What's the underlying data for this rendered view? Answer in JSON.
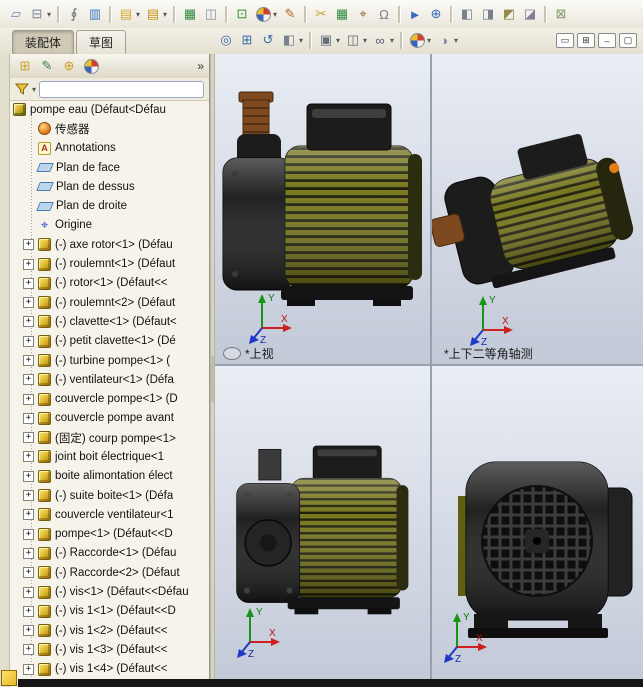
{
  "toolbar_main": {
    "icons": [
      {
        "name": "new-document-icon",
        "glyph": "▱",
        "color": "#6a86b8"
      },
      {
        "name": "print-icon",
        "glyph": "⊟",
        "color": "#7a8699"
      },
      {
        "name": "print-dropdown-icon",
        "glyph": "▾",
        "cls": "dd"
      },
      {
        "name": "separator",
        "cls": "sep"
      },
      {
        "name": "attachment-icon",
        "glyph": "∮",
        "color": "#5a6470"
      },
      {
        "name": "column-chart-icon",
        "glyph": "▥",
        "color": "#3c76c2"
      },
      {
        "name": "separator",
        "cls": "sep"
      },
      {
        "name": "open-folder-icon",
        "glyph": "▤",
        "color": "#d7a928"
      },
      {
        "name": "open-folder-dropdown-icon",
        "glyph": "▾",
        "cls": "dd"
      },
      {
        "name": "open-document-icon",
        "glyph": "▤",
        "color": "#c79418"
      },
      {
        "name": "open-document-dropdown-icon",
        "glyph": "▾",
        "cls": "dd"
      },
      {
        "name": "separator",
        "cls": "sep"
      },
      {
        "name": "save-icon",
        "glyph": "▦",
        "color": "#2f8a3f"
      },
      {
        "name": "window-panes-icon",
        "glyph": "◫",
        "color": "#8a94a4"
      },
      {
        "name": "separator",
        "cls": "sep"
      },
      {
        "name": "rebuild-icon",
        "glyph": "⊡",
        "color": "#2f9a2f"
      },
      {
        "name": "appearance-ball-icon",
        "cls": "ball"
      },
      {
        "name": "appearance-dropdown-icon",
        "glyph": "▾",
        "cls": "dd"
      },
      {
        "name": "edit-sketch-icon",
        "glyph": "✎",
        "color": "#b06a28"
      },
      {
        "name": "separator",
        "cls": "sep"
      },
      {
        "name": "trim-icon",
        "glyph": "✂",
        "color": "#c2a224"
      },
      {
        "name": "design-table-icon",
        "glyph": "▦",
        "color": "#2f8a3f"
      },
      {
        "name": "measure-icon",
        "glyph": "⌖",
        "color": "#8a6a20"
      },
      {
        "name": "mass-properties-icon",
        "glyph": "Ω",
        "color": "#76808e"
      },
      {
        "name": "separator",
        "cls": "sep"
      },
      {
        "name": "select-arrow-icon",
        "glyph": "►",
        "color": "#3a6ac0"
      },
      {
        "name": "move-component-icon",
        "glyph": "⊕",
        "color": "#3a6ac0"
      },
      {
        "name": "separator",
        "cls": "sep"
      },
      {
        "name": "isometric-view-icon",
        "glyph": "◧",
        "color": "#76808e"
      },
      {
        "name": "section-view-icon",
        "glyph": "◨",
        "color": "#76808e"
      },
      {
        "name": "assembly-cube-icon",
        "glyph": "◩",
        "color": "#9a8a4a"
      },
      {
        "name": "exploded-view-icon",
        "glyph": "◪",
        "color": "#8a7a9a"
      },
      {
        "name": "separator",
        "cls": "sep"
      },
      {
        "name": "interference-check-icon",
        "glyph": "⊠",
        "color": "#7a9a6a"
      }
    ]
  },
  "command_tabs": {
    "assembly": "装配体",
    "sketch": "草图"
  },
  "view_toolbar": {
    "icons": [
      {
        "name": "zoom-fit-icon",
        "glyph": "◎",
        "color": "#3a6aaa"
      },
      {
        "name": "zoom-area-icon",
        "glyph": "⊞",
        "color": "#3a6aaa"
      },
      {
        "name": "previous-view-icon",
        "glyph": "↺",
        "color": "#3a6aaa"
      },
      {
        "name": "section-view-icon",
        "glyph": "◧",
        "color": "#76808e"
      },
      {
        "name": "section-dropdown-icon",
        "glyph": "▾",
        "cls": "dd"
      },
      {
        "name": "separator",
        "cls": "sep"
      },
      {
        "name": "view-orientation-icon",
        "glyph": "▣",
        "color": "#666e7a"
      },
      {
        "name": "view-orientation-dropdown-icon",
        "glyph": "▾",
        "cls": "dd"
      },
      {
        "name": "display-style-icon",
        "glyph": "◫",
        "color": "#666e7a"
      },
      {
        "name": "display-style-dropdown-icon",
        "glyph": "▾",
        "cls": "dd"
      },
      {
        "name": "hide-show-items-icon",
        "glyph": "∞",
        "color": "#556070"
      },
      {
        "name": "hide-show-dropdown-icon",
        "glyph": "▾",
        "cls": "dd"
      },
      {
        "name": "separator",
        "cls": "sep"
      },
      {
        "name": "edit-appearance-icon",
        "cls": "ball"
      },
      {
        "name": "edit-appearance-dropdown-icon",
        "glyph": "▾",
        "cls": "dd"
      },
      {
        "name": "scene-icon",
        "glyph": "◑",
        "color": "#7a86a0"
      },
      {
        "name": "scene-dropdown-icon",
        "glyph": "▾",
        "cls": "dd"
      }
    ],
    "right_icons": [
      {
        "name": "viewport-single-icon",
        "glyph": "▭",
        "cls": "winbox"
      },
      {
        "name": "viewport-split-icon",
        "glyph": "⊞",
        "cls": "winbox"
      },
      {
        "name": "minimize-window-icon",
        "glyph": "–",
        "cls": "winbox"
      },
      {
        "name": "restore-window-icon",
        "glyph": "▢",
        "cls": "winbox"
      }
    ]
  },
  "panel": {
    "tabs": [
      {
        "name": "featuremanager-tab-icon",
        "glyph": "⊞",
        "color": "#caa227"
      },
      {
        "name": "propertymanager-tab-icon",
        "glyph": "✎",
        "color": "#3f7f3f"
      },
      {
        "name": "configurationmanager-tab-icon",
        "glyph": "⊕",
        "color": "#caa227"
      },
      {
        "name": "appearances-tab-icon",
        "cls": "ball"
      }
    ],
    "chevron": "»",
    "filter": {
      "value": "",
      "placeholder": ""
    }
  },
  "tree": {
    "items": [
      {
        "name": "tree-item-root-pompe-eau",
        "cls": "asm root",
        "exp": "",
        "label": "pompe eau (Défaut<Défau"
      },
      {
        "name": "tree-item-sensors",
        "cls": "sensor",
        "exp": "",
        "label": "传感器"
      },
      {
        "name": "tree-item-annotations",
        "cls": "ann",
        "exp": "",
        "label": "Annotations"
      },
      {
        "name": "tree-item-plan-de-face",
        "cls": "plane",
        "exp": "",
        "label": "Plan de face"
      },
      {
        "name": "tree-item-plan-de-dessus",
        "cls": "plane",
        "exp": "",
        "label": "Plan de dessus"
      },
      {
        "name": "tree-item-plan-de-droite",
        "cls": "plane",
        "exp": "",
        "label": "Plan de droite"
      },
      {
        "name": "tree-item-origine",
        "cls": "origin",
        "exp": "",
        "label": "Origine"
      },
      {
        "name": "tree-item-axe-rotor-1",
        "cls": "part",
        "exp": "+",
        "label": "(-) axe rotor<1> (Défau"
      },
      {
        "name": "tree-item-roulemnt-1",
        "cls": "part",
        "exp": "+",
        "label": "(-) roulemnt<1> (Défaut"
      },
      {
        "name": "tree-item-rotor-1",
        "cls": "part",
        "exp": "+",
        "label": "(-) rotor<1> (Défaut<<"
      },
      {
        "name": "tree-item-roulemnt-2",
        "cls": "part",
        "exp": "+",
        "label": "(-) roulemnt<2> (Défaut"
      },
      {
        "name": "tree-item-clavette-1",
        "cls": "part",
        "exp": "+",
        "label": "(-) clavette<1> (Défaut<"
      },
      {
        "name": "tree-item-petit-clavette-1",
        "cls": "part",
        "exp": "+",
        "label": "(-) petit clavette<1> (Dé"
      },
      {
        "name": "tree-item-turbine-pompe-1",
        "cls": "part",
        "exp": "+",
        "label": "(-) turbine pompe<1> ("
      },
      {
        "name": "tree-item-ventilateur-1",
        "cls": "part",
        "exp": "+",
        "label": "(-) ventilateur<1> (Défa"
      },
      {
        "name": "tree-item-couvercle-pompe-1",
        "cls": "part",
        "exp": "+",
        "label": "couvercle pompe<1> (D"
      },
      {
        "name": "tree-item-couvercle-pompe-avant",
        "cls": "part",
        "exp": "+",
        "label": "couvercle pompe avant"
      },
      {
        "name": "tree-item-courp-pompe-1",
        "cls": "part",
        "exp": "+",
        "label": "(固定) courp pompe<1>"
      },
      {
        "name": "tree-item-joint-boit-electrique-1",
        "cls": "part",
        "exp": "+",
        "label": "joint boit électrique<1"
      },
      {
        "name": "tree-item-boite-alimontation-elect",
        "cls": "part",
        "exp": "+",
        "label": "boite alimontation élect"
      },
      {
        "name": "tree-item-suite-boite-1",
        "cls": "part",
        "exp": "+",
        "label": "(-) suite boite<1> (Défa"
      },
      {
        "name": "tree-item-couvercle-ventilateur-1",
        "cls": "part",
        "exp": "+",
        "label": "couvercle ventilateur<1"
      },
      {
        "name": "tree-item-pompe-1",
        "cls": "part",
        "exp": "+",
        "label": "pompe<1> (Défaut<<D"
      },
      {
        "name": "tree-item-raccorde-1",
        "cls": "part",
        "exp": "+",
        "label": "(-) Raccorde<1> (Défau"
      },
      {
        "name": "tree-item-raccorde-2",
        "cls": "part",
        "exp": "+",
        "label": "(-) Raccorde<2> (Défaut"
      },
      {
        "name": "tree-item-vis-1",
        "cls": "part",
        "exp": "+",
        "label": "(-) vis<1> (Défaut<<Défau"
      },
      {
        "name": "tree-item-vis1-1",
        "cls": "part",
        "exp": "+",
        "label": "(-) vis 1<1> (Défaut<<D"
      },
      {
        "name": "tree-item-vis1-2",
        "cls": "part",
        "exp": "+",
        "label": "(-) vis 1<2> (Défaut<<"
      },
      {
        "name": "tree-item-vis1-3",
        "cls": "part",
        "exp": "+",
        "label": "(-) vis 1<3> (Défaut<<"
      },
      {
        "name": "tree-item-vis1-4",
        "cls": "part",
        "exp": "+",
        "label": "(-) vis 1<4> (Défaut<<"
      }
    ]
  },
  "viewports": {
    "tl_label": "*上视",
    "tr_label": "*上下二等角轴测",
    "triad": {
      "x": "X",
      "y": "Y",
      "z": "Z"
    }
  },
  "colors": {
    "olive": "#74741a",
    "fin": "#1b1b08",
    "pump_black": "#1c1c1c",
    "fitting_brown": "#7c4a1e",
    "accent_orange": "#e67d1a",
    "vp_top": "#e9edf4",
    "vp_bottom": "#c2c9d7",
    "taskpane_yellow": "#e8b92a"
  }
}
